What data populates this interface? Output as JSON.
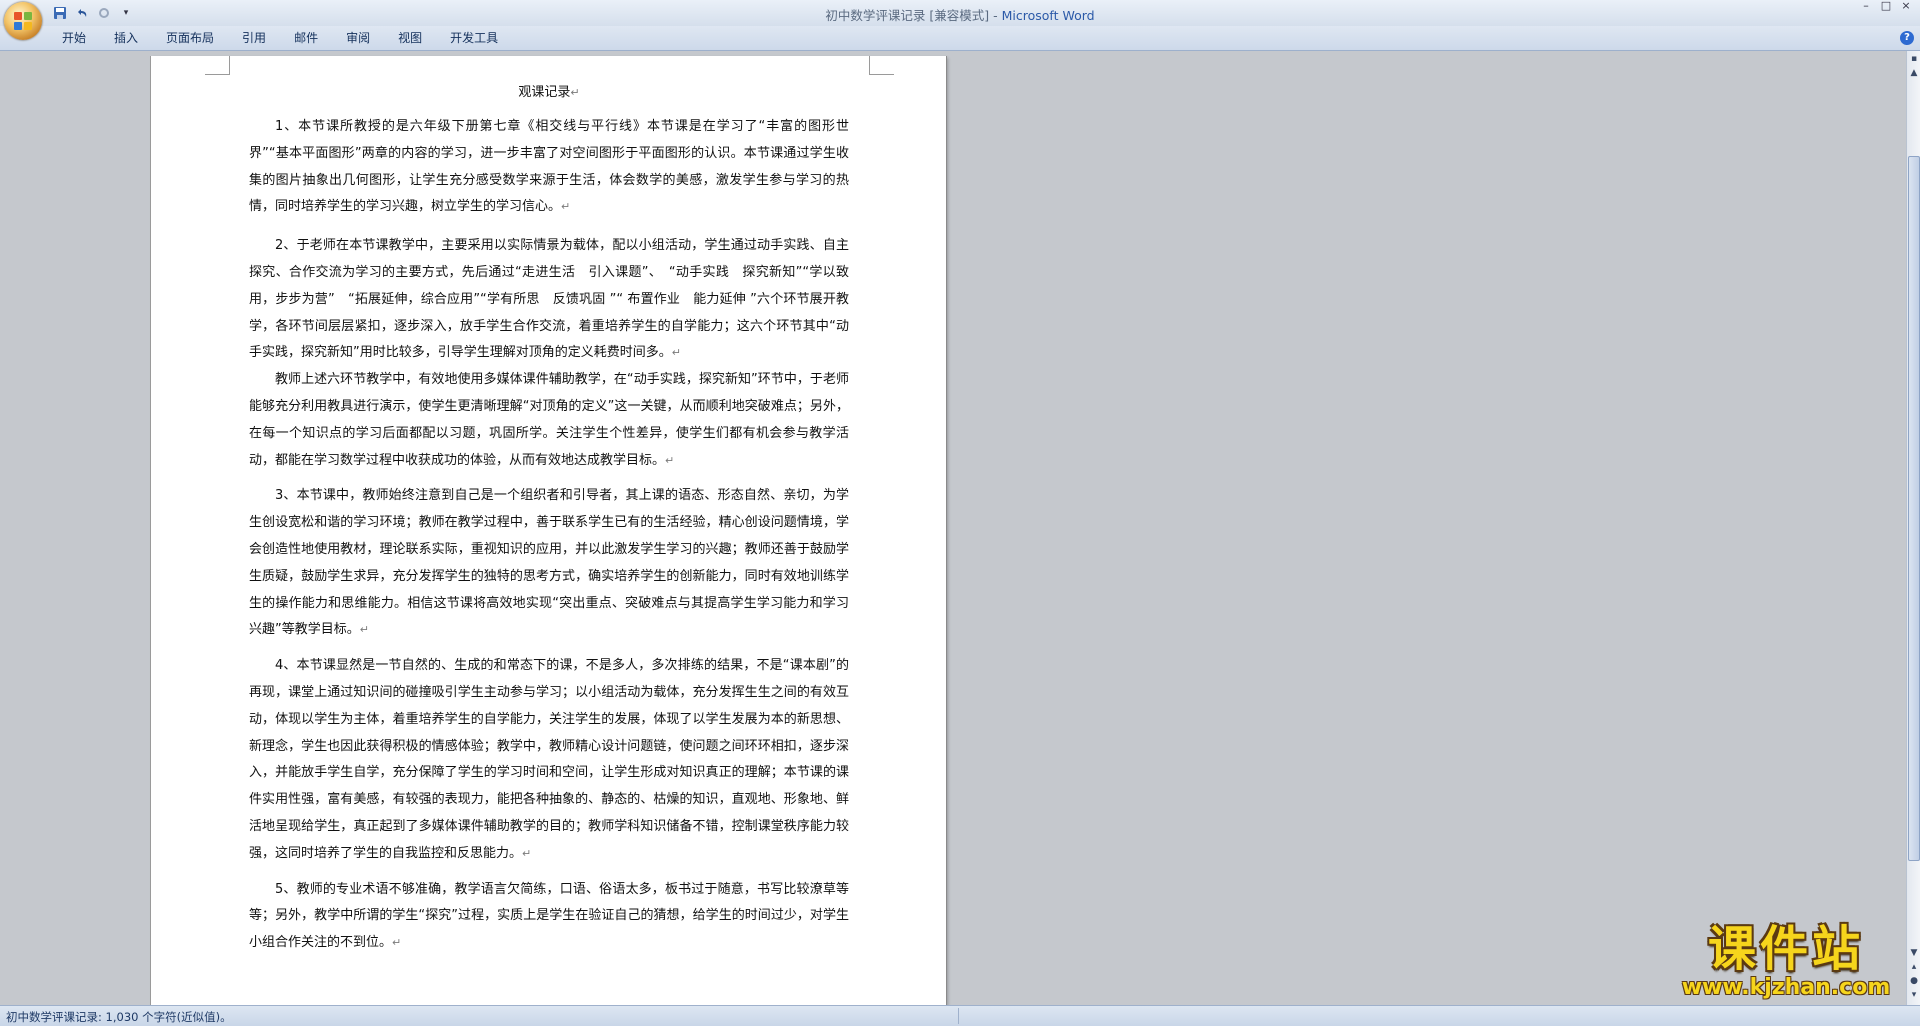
{
  "window": {
    "title_doc": "初中数学评课记录 [兼容模式]",
    "title_sep": " - ",
    "title_app": "Microsoft Word",
    "controls": [
      "–",
      "□",
      "×"
    ]
  },
  "quick_access": [
    "save-icon",
    "undo-icon",
    "redo-icon",
    "customize-icon"
  ],
  "ribbon": {
    "tabs": [
      "开始",
      "插入",
      "页面布局",
      "引用",
      "邮件",
      "审阅",
      "视图",
      "开发工具"
    ],
    "help": "?"
  },
  "document": {
    "title": "观课记录",
    "paragraphs": [
      "1、本节课所教授的是六年级下册第七章《相交线与平行线》本节课是在学习了“丰富的图形世界”“基本平面图形”两章的内容的学习，进一步丰富了对空间图形于平面图形的认识。本节课通过学生收集的图片抽象出几何图形，让学生充分感受数学来源于生活，体会数学的美感，激发学生参与学习的热情，同时培养学生的学习兴趣，树立学生的学习信心。",
      "2、于老师在本节课教学中，主要采用以实际情景为载体，配以小组活动，学生通过动手实践、自主探究、合作交流为学习的主要方式，先后通过“走进生活　引入课题”、　“动手实践　探究新知”“学以致用，步步为营”　“拓展延伸，综合应用”“学有所思　反馈巩固 ”“ 布置作业　能力延伸 ”六个环节展开教学，各环节间层层紧扣，逐步深入，放手学生合作交流，着重培养学生的自学能力；这六个环节其中“动手实践，探究新知”用时比较多，引导学生理解对顶角的定义耗费时间多。",
      "教师上述六环节教学中，有效地使用多媒体课件辅助教学，在“动手实践，探究新知”环节中，于老师能够充分利用教具进行演示，使学生更清晰理解“对顶角的定义”这一关键，从而顺利地突破难点；另外，在每一个知识点的学习后面都配以习题，巩固所学。关注学生个性差异，使学生们都有机会参与教学活动，都能在学习数学过程中收获成功的体验，从而有效地达成教学目标。",
      "3、本节课中，教师始终注意到自己是一个组织者和引导者，其上课的语态、形态自然、亲切，为学生创设宽松和谐的学习环境；教师在教学过程中，善于联系学生已有的生活经验，精心创设问题情境，学会创造性地使用教材，理论联系实际，重视知识的应用，并以此激发学生学习的兴趣；教师还善于鼓励学生质疑，鼓励学生求异，充分发挥学生的独特的思考方式，确实培养学生的创新能力，同时有效地训练学生的操作能力和思维能力。相信这节课将高效地实现“突出重点、突破难点与其提高学生学习能力和学习兴趣”等教学目标。",
      "4、本节课显然是一节自然的、生成的和常态下的课，不是多人，多次排练的结果，不是“课本剧”的再现，课堂上通过知识间的碰撞吸引学生主动参与学习；以小组活动为载体，充分发挥生生之间的有效互动，体现以学生为主体，着重培养学生的自学能力，关注学生的发展，体现了以学生发展为本的新思想、新理念，学生也因此获得积极的情感体验；教学中，教师精心设计问题链，使问题之间环环相扣，逐步深入，并能放手学生自学，充分保障了学生的学习时间和空间，让学生形成对知识真正的理解；本节课的课件实用性强，富有美感，有较强的表现力，能把各种抽象的、静态的、枯燥的知识，直观地、形象地、鲜活地呈现给学生，真正起到了多媒体课件辅助教学的目的；教师学科知识储备不错，控制课堂秩序能力较强，这同时培养了学生的自我监控和反思能力。",
      "5、教师的专业术语不够准确，教学语言欠简练，口语、俗语太多，板书过于随意，书写比较潦草等等；另外，教学中所谓的学生“探究”过程，实质上是学生在验证自己的猜想，给学生的时间过少，对学生小组合作关注的不到位。"
    ],
    "paragraph_mark": "↵"
  },
  "status_bar": {
    "text": "初中数学评课记录: 1,030 个字符(近似值)。"
  },
  "watermark": {
    "cn": "课件站",
    "url": "www.kjzhan.com"
  },
  "colors": {
    "brand_title": "#2c5aa8",
    "watermark": "#f6d51c"
  }
}
